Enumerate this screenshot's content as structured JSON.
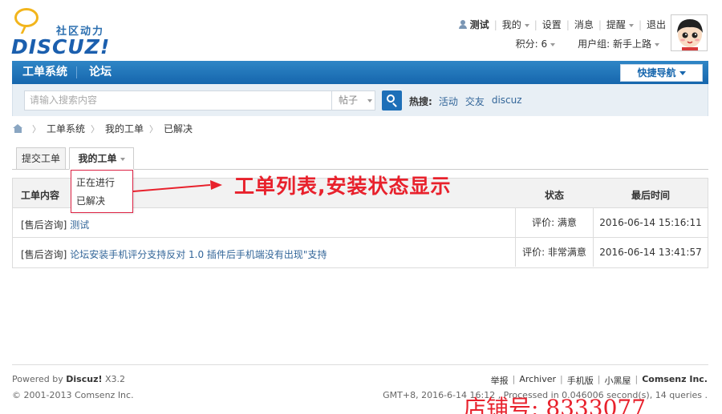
{
  "logo": {
    "subtitle": "社区动力",
    "main": "DISCUZ!"
  },
  "usernav": {
    "username": "测试",
    "items": [
      "我的",
      "设置",
      "消息",
      "提醒",
      "退出"
    ],
    "points": "积分: 6",
    "usergroup": "用户组: 新手上路"
  },
  "navbar": {
    "items": [
      "工单系统",
      "论坛"
    ],
    "quicknav": "快捷导航"
  },
  "search": {
    "placeholder": "请输入搜索内容",
    "type": "帖子",
    "hot_label": "热搜:",
    "hot_words": [
      "活动",
      "交友",
      "discuz"
    ]
  },
  "breadcrumb": [
    "工单系统",
    "我的工单",
    "已解决"
  ],
  "tabs": [
    "提交工单",
    "我的工单"
  ],
  "dropdown": [
    "正在进行",
    "已解决"
  ],
  "annotation": "工单列表,安装状态显示",
  "table": {
    "headers": [
      "工单内容",
      "状态",
      "最后时间"
    ],
    "rows": [
      {
        "category": "[售后咨询]",
        "title": "测试",
        "status": "评价: 满意",
        "time": "2016-06-14 15:16:11"
      },
      {
        "category": "[售后咨询]",
        "title": "论坛安装手机评分支持反对 1.0 插件后手机端没有出现\"支持",
        "status": "评价: 非常满意",
        "time": "2016-06-14 13:41:57"
      }
    ]
  },
  "footer": {
    "powered_prefix": "Powered by",
    "powered_brand": "Discuz!",
    "version": "X3.2",
    "copyright": "© 2001-2013 Comsenz Inc.",
    "links": [
      "举报",
      "Archiver",
      "手机版",
      "小黑屋",
      "Comsenz Inc."
    ],
    "stats": "GMT+8, 2016-6-14 16:12 , Processed in 0.046006 second(s), 14 queries ."
  },
  "watermark": "店铺号:  8333077",
  "colors": {
    "brand_blue": "#1666ad",
    "annotation_red": "#e8212c",
    "logo_yellow": "#f2b51c"
  }
}
